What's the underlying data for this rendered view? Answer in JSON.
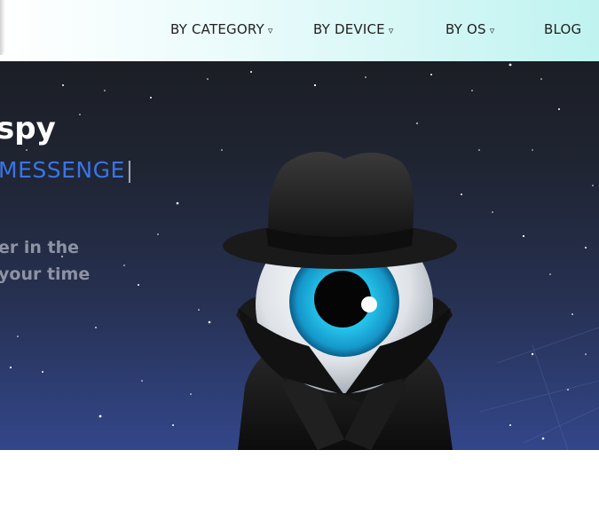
{
  "nav": {
    "items": [
      {
        "label": "BY CATEGORY",
        "has_dropdown": true
      },
      {
        "label": "BY DEVICE",
        "has_dropdown": true
      },
      {
        "label": "BY OS",
        "has_dropdown": true
      },
      {
        "label": "BLOG",
        "has_dropdown": false
      }
    ],
    "dropdown_glyph": "▿"
  },
  "hero": {
    "title": "spy",
    "typed_text": "MESSENGE",
    "cursor": "|",
    "lines": [
      "er in the",
      "your time"
    ]
  },
  "colors": {
    "typed_text": "#3a74e6",
    "hero_top": "#1b1e25",
    "hero_bottom": "#33468a",
    "nav_gradient_end": "#bff3f0"
  },
  "icons": {
    "mascot": "spy-eye-mascot-icon",
    "dropdown": "chevron-down-icon"
  }
}
